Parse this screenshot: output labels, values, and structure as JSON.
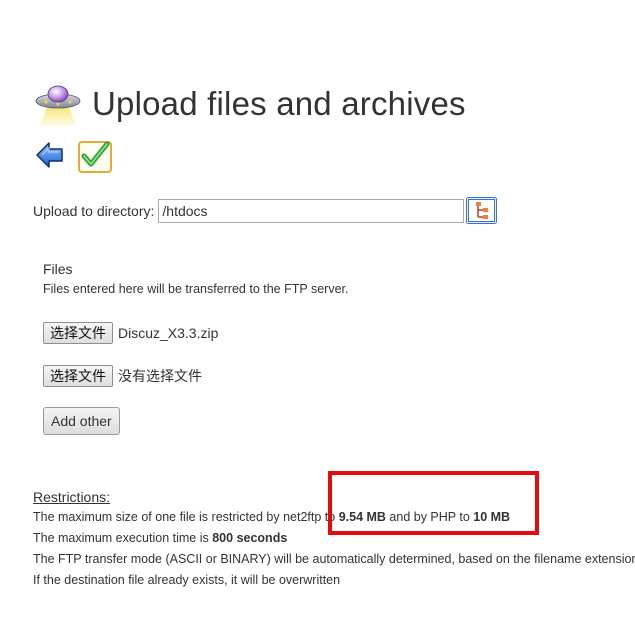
{
  "page": {
    "title": "Upload files and archives"
  },
  "toolbar": {
    "back_icon": "back-arrow-icon",
    "confirm_icon": "checkmark-icon"
  },
  "directory": {
    "label": "Upload to directory:",
    "value": "/htdocs",
    "browse_icon": "tree-browse-icon"
  },
  "files": {
    "heading": "Files",
    "description": "Files entered here will be transferred to the FTP server.",
    "rows": [
      {
        "button_label": "选择文件",
        "file_name": "Discuz_X3.3.zip"
      },
      {
        "button_label": "选择文件",
        "file_name": "没有选择文件"
      }
    ],
    "add_other_label": "Add other"
  },
  "restrictions": {
    "heading": "Restrictions:",
    "max_size": {
      "prefix": "The maximum size of one file is restricted by net2ftp to ",
      "net2ftp_limit": "9.54 MB",
      "middle": " and by PHP to ",
      "php_limit": "10 MB"
    },
    "max_time": {
      "prefix": "The maximum execution time is ",
      "value": "800 seconds"
    },
    "transfer_mode": "The FTP transfer mode (ASCII or BINARY) will be automatically determined, based on the filename extension",
    "overwrite": "If the destination file already exists, it will be overwritten"
  },
  "colors": {
    "highlight": "#e8090f",
    "text": "#333333"
  }
}
